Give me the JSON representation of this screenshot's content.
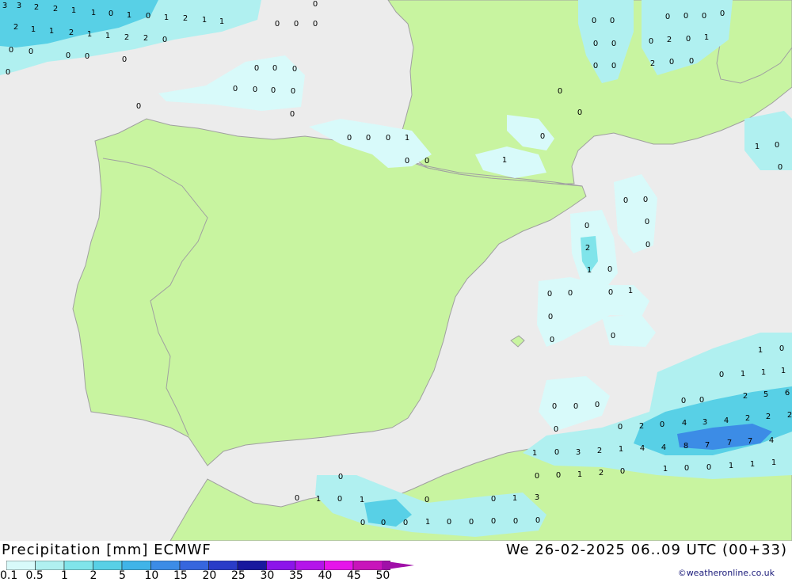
{
  "title": "Precipitation [mm] ECMWF",
  "valid_time": "We 26-02-2025 06..09 UTC (00+33)",
  "credit": "©weatheronline.co.uk",
  "colors": {
    "sea": "#ececec",
    "land": "#c8f4a0",
    "border": "#a0a0a0",
    "scale": [
      "#d8fafa",
      "#b0f0f0",
      "#80e4ea",
      "#58d0e6",
      "#40b4e8",
      "#3c8ce6",
      "#3666de",
      "#2a3cc8",
      "#18189e",
      "#8c14ea",
      "#b414ea",
      "#e614ea",
      "#c814ba",
      "#a010a8"
    ]
  },
  "scale_labels": [
    "0.1",
    "0.5",
    "1",
    "2",
    "5",
    "10",
    "15",
    "20",
    "25",
    "30",
    "35",
    "40",
    "45",
    "50"
  ],
  "values": [
    {
      "v": "3"
    },
    {
      "v": "3"
    },
    {
      "v": "2"
    },
    {
      "v": "2"
    },
    {
      "v": "1"
    },
    {
      "v": "1"
    },
    {
      "v": "0"
    },
    {
      "v": "1"
    },
    {
      "v": "0"
    },
    {
      "v": "1"
    },
    {
      "v": "2"
    },
    {
      "v": "1"
    },
    {
      "v": "1"
    },
    {
      "v": "2"
    },
    {
      "v": "1"
    },
    {
      "v": "1"
    },
    {
      "v": "2"
    },
    {
      "v": "1"
    },
    {
      "v": "1"
    },
    {
      "v": "2"
    },
    {
      "v": "2"
    },
    {
      "v": "0"
    },
    {
      "v": "0"
    },
    {
      "v": "0"
    },
    {
      "v": "0"
    },
    {
      "v": "0"
    },
    {
      "v": "0"
    },
    {
      "v": "0"
    },
    {
      "v": "0"
    },
    {
      "v": "0"
    },
    {
      "v": "0"
    },
    {
      "v": "0"
    },
    {
      "v": "0"
    },
    {
      "v": "0"
    },
    {
      "v": "0"
    },
    {
      "v": "0"
    },
    {
      "v": "0"
    },
    {
      "v": "0"
    },
    {
      "v": "0"
    },
    {
      "v": "0"
    },
    {
      "v": "0"
    },
    {
      "v": "0"
    },
    {
      "v": "0"
    },
    {
      "v": "0"
    },
    {
      "v": "1"
    },
    {
      "v": "0"
    },
    {
      "v": "0"
    },
    {
      "v": "1"
    },
    {
      "v": "0"
    },
    {
      "v": "0"
    },
    {
      "v": "0"
    },
    {
      "v": "0"
    },
    {
      "v": "0"
    },
    {
      "v": "0"
    },
    {
      "v": "0"
    },
    {
      "v": "0"
    },
    {
      "v": "0"
    },
    {
      "v": "0"
    },
    {
      "v": "0"
    },
    {
      "v": "0"
    },
    {
      "v": "0"
    },
    {
      "v": "0"
    },
    {
      "v": "2"
    },
    {
      "v": "0"
    },
    {
      "v": "1"
    },
    {
      "v": "2"
    },
    {
      "v": "0"
    },
    {
      "v": "0"
    },
    {
      "v": "1"
    },
    {
      "v": "0"
    },
    {
      "v": "0"
    },
    {
      "v": "0"
    },
    {
      "v": "0"
    },
    {
      "v": "0"
    },
    {
      "v": "0"
    },
    {
      "v": "2"
    },
    {
      "v": "1"
    },
    {
      "v": "0"
    },
    {
      "v": "0"
    },
    {
      "v": "1"
    },
    {
      "v": "0"
    },
    {
      "v": "0"
    },
    {
      "v": "0"
    },
    {
      "v": "0"
    },
    {
      "v": "0"
    },
    {
      "v": "0"
    },
    {
      "v": "1"
    },
    {
      "v": "0"
    },
    {
      "v": "0"
    },
    {
      "v": "1"
    },
    {
      "v": "1"
    },
    {
      "v": "1"
    },
    {
      "v": "0"
    },
    {
      "v": "0"
    },
    {
      "v": "2"
    },
    {
      "v": "5"
    },
    {
      "v": "6"
    },
    {
      "v": "4"
    },
    {
      "v": "3"
    },
    {
      "v": "4"
    },
    {
      "v": "2"
    },
    {
      "v": "2"
    },
    {
      "v": "2"
    },
    {
      "v": "0"
    },
    {
      "v": "0"
    },
    {
      "v": "0"
    },
    {
      "v": "0"
    },
    {
      "v": "0"
    },
    {
      "v": "2"
    },
    {
      "v": "0"
    },
    {
      "v": "4"
    },
    {
      "v": "4"
    },
    {
      "v": "8"
    },
    {
      "v": "7"
    },
    {
      "v": "7"
    },
    {
      "v": "7"
    },
    {
      "v": "4"
    },
    {
      "v": "1"
    },
    {
      "v": "0"
    },
    {
      "v": "3"
    },
    {
      "v": "2"
    },
    {
      "v": "1"
    },
    {
      "v": "0"
    },
    {
      "v": "0"
    },
    {
      "v": "1"
    },
    {
      "v": "2"
    },
    {
      "v": "0"
    },
    {
      "v": "1"
    },
    {
      "v": "0"
    },
    {
      "v": "0"
    },
    {
      "v": "1"
    },
    {
      "v": "1"
    },
    {
      "v": "1"
    },
    {
      "v": "0"
    },
    {
      "v": "0"
    },
    {
      "v": "1"
    },
    {
      "v": "0"
    },
    {
      "v": "1"
    },
    {
      "v": "0"
    },
    {
      "v": "0"
    },
    {
      "v": "1"
    },
    {
      "v": "3"
    },
    {
      "v": "0"
    },
    {
      "v": "0"
    },
    {
      "v": "0"
    },
    {
      "v": "1"
    },
    {
      "v": "0"
    },
    {
      "v": "0"
    },
    {
      "v": "0"
    },
    {
      "v": "0"
    },
    {
      "v": "0"
    }
  ]
}
